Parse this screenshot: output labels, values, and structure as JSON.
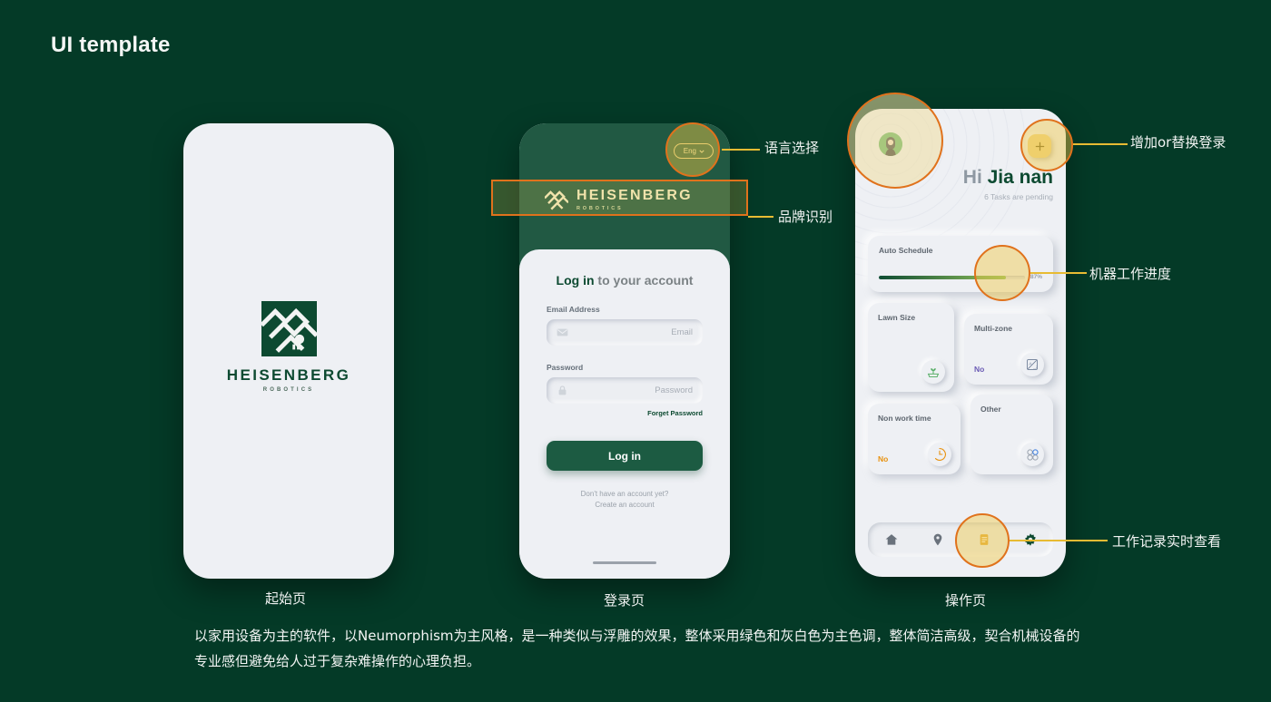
{
  "page": {
    "title": "UI template",
    "background_color": "#043a27",
    "accent_gold": "#e8bb33",
    "accent_orange": "#e0721c",
    "brand_green": "#0d4a31"
  },
  "brand": {
    "name": "HEISENBERG",
    "sub": "ROBOTICS",
    "logo_icon": "heisenberg-interlock-logo-icon"
  },
  "screens": {
    "splash": {
      "caption": "起始页"
    },
    "login": {
      "caption": "登录页",
      "language_pill": {
        "label": "Eng",
        "chevron_icon": "chevron-down-icon"
      },
      "title_strong": "Log in",
      "title_rest": " to your account",
      "email": {
        "label": "Email Address",
        "placeholder": "Email",
        "icon": "envelope-icon",
        "value": ""
      },
      "password": {
        "label": "Password",
        "placeholder": "Password",
        "icon": "lock-icon",
        "value": ""
      },
      "forget_password": "Forget Password",
      "submit_label": "Log in",
      "no_account": "Don't have an account yet?",
      "create_account": "Create an account"
    },
    "dashboard": {
      "caption": "操作页",
      "avatar_icon": "user-avatar-icon",
      "add_button_icon": "plus-icon",
      "greeting_prefix": "Hi ",
      "user_name": "Jia nan",
      "tasks_status": "6 Tasks are pending",
      "cards": [
        {
          "id": "auto-schedule",
          "title": "Auto Schedule",
          "progress_pct": 87,
          "progress_label": "87%",
          "icon": "mower-robot-icon"
        },
        {
          "id": "lawn-size",
          "title": "Lawn Size",
          "value": "",
          "icon": "lawn-sprout-icon"
        },
        {
          "id": "multi-zone",
          "title": "Multi-zone",
          "value": "No",
          "value_color": "#6b5bb5",
          "icon": "zone-map-icon"
        },
        {
          "id": "non-work-time",
          "title": "Non work time",
          "value": "No",
          "value_color": "#e8920f",
          "icon": "clock-icon"
        },
        {
          "id": "other",
          "title": "Other",
          "value": "",
          "icon": "grid-four-circles-icon"
        }
      ],
      "nav": [
        {
          "id": "home",
          "icon": "home-icon",
          "active": false
        },
        {
          "id": "map",
          "icon": "location-pin-icon",
          "active": false
        },
        {
          "id": "records",
          "icon": "document-list-icon",
          "active": true
        },
        {
          "id": "settings",
          "icon": "gear-icon",
          "active": false
        }
      ]
    }
  },
  "annotations": [
    {
      "id": "language-select",
      "text": "语言选择"
    },
    {
      "id": "brand-identity",
      "text": "品牌识别"
    },
    {
      "id": "add-or-switch-login",
      "text": "增加or替换登录"
    },
    {
      "id": "machine-progress",
      "text": "机器工作进度"
    },
    {
      "id": "work-log-realtime",
      "text": "工作记录实时查看"
    }
  ],
  "description": "以家用设备为主的软件，以Neumorphism为主风格，是一种类似与浮雕的效果，整体采用绿色和灰白色为主色调，整体简洁高级，契合机械设备的专业感但避免给人过于复杂难操作的心理负担。"
}
